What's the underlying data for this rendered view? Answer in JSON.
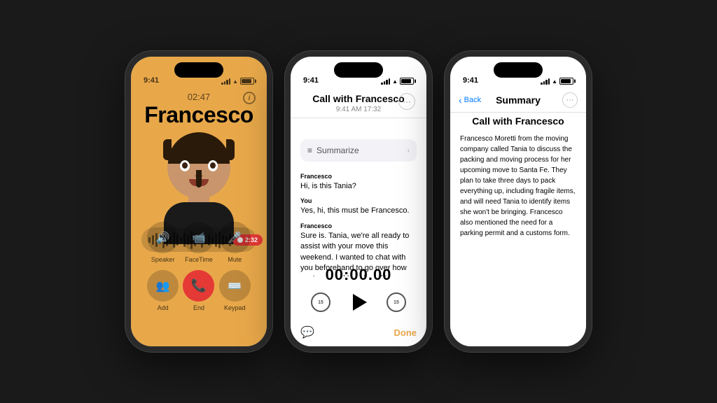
{
  "background": "#1a1a1a",
  "phones": {
    "phone1": {
      "title": "Active Call Screen",
      "status": {
        "time": "9:41",
        "signal": [
          2,
          4,
          6,
          8,
          10
        ],
        "wifi": "wifi",
        "battery": "75"
      },
      "call_time": "02:47",
      "caller_name": "Francesco",
      "waveform_timer": "2:32",
      "controls": [
        {
          "icon": "🔊",
          "label": "Speaker"
        },
        {
          "icon": "📹",
          "label": "FaceTime"
        },
        {
          "icon": "🎤",
          "label": "Mute"
        },
        {
          "icon": "👤",
          "label": "Add"
        },
        {
          "icon": "📞",
          "label": "End",
          "type": "end"
        },
        {
          "icon": "⌨️",
          "label": "Keypad"
        }
      ]
    },
    "phone2": {
      "title": "Transcript Screen",
      "status": {
        "time": "9:41",
        "signal": [
          2,
          4,
          6,
          8,
          10
        ],
        "wifi": "wifi",
        "battery": "75"
      },
      "header_title": "Call with Francesco",
      "header_subtitle": "9:41 AM  17:32",
      "summarize_label": "Summarize",
      "transcript": [
        {
          "speaker": "Francesco",
          "text": "Hi, is this Tania?"
        },
        {
          "speaker": "You",
          "text": "Yes, hi, this must be Francesco."
        },
        {
          "speaker": "Francesco",
          "text": "Sure is. Tania, we're all ready to assist with your move this weekend. I wanted to chat with you beforehand to go over how my team and I work and to answer any questions you might have before we arrive Saturday"
        }
      ],
      "playback_time": "00:00.00",
      "done_label": "Done"
    },
    "phone3": {
      "title": "Summary Screen",
      "status": {
        "time": "9:41",
        "signal": [
          2,
          4,
          6,
          8,
          10
        ],
        "wifi": "wifi",
        "battery": "75"
      },
      "nav_back": "Back",
      "nav_title": "Summary",
      "call_title": "Call with Francesco",
      "summary_text": "Francesco Moretti from the moving company called Tania to discuss the packing and moving process for her upcoming move to Santa Fe. They plan to take three days to pack everything up, including fragile items, and will need Tania to identify items she won't be bringing. Francesco also mentioned the need for a parking permit and a customs form."
    }
  }
}
